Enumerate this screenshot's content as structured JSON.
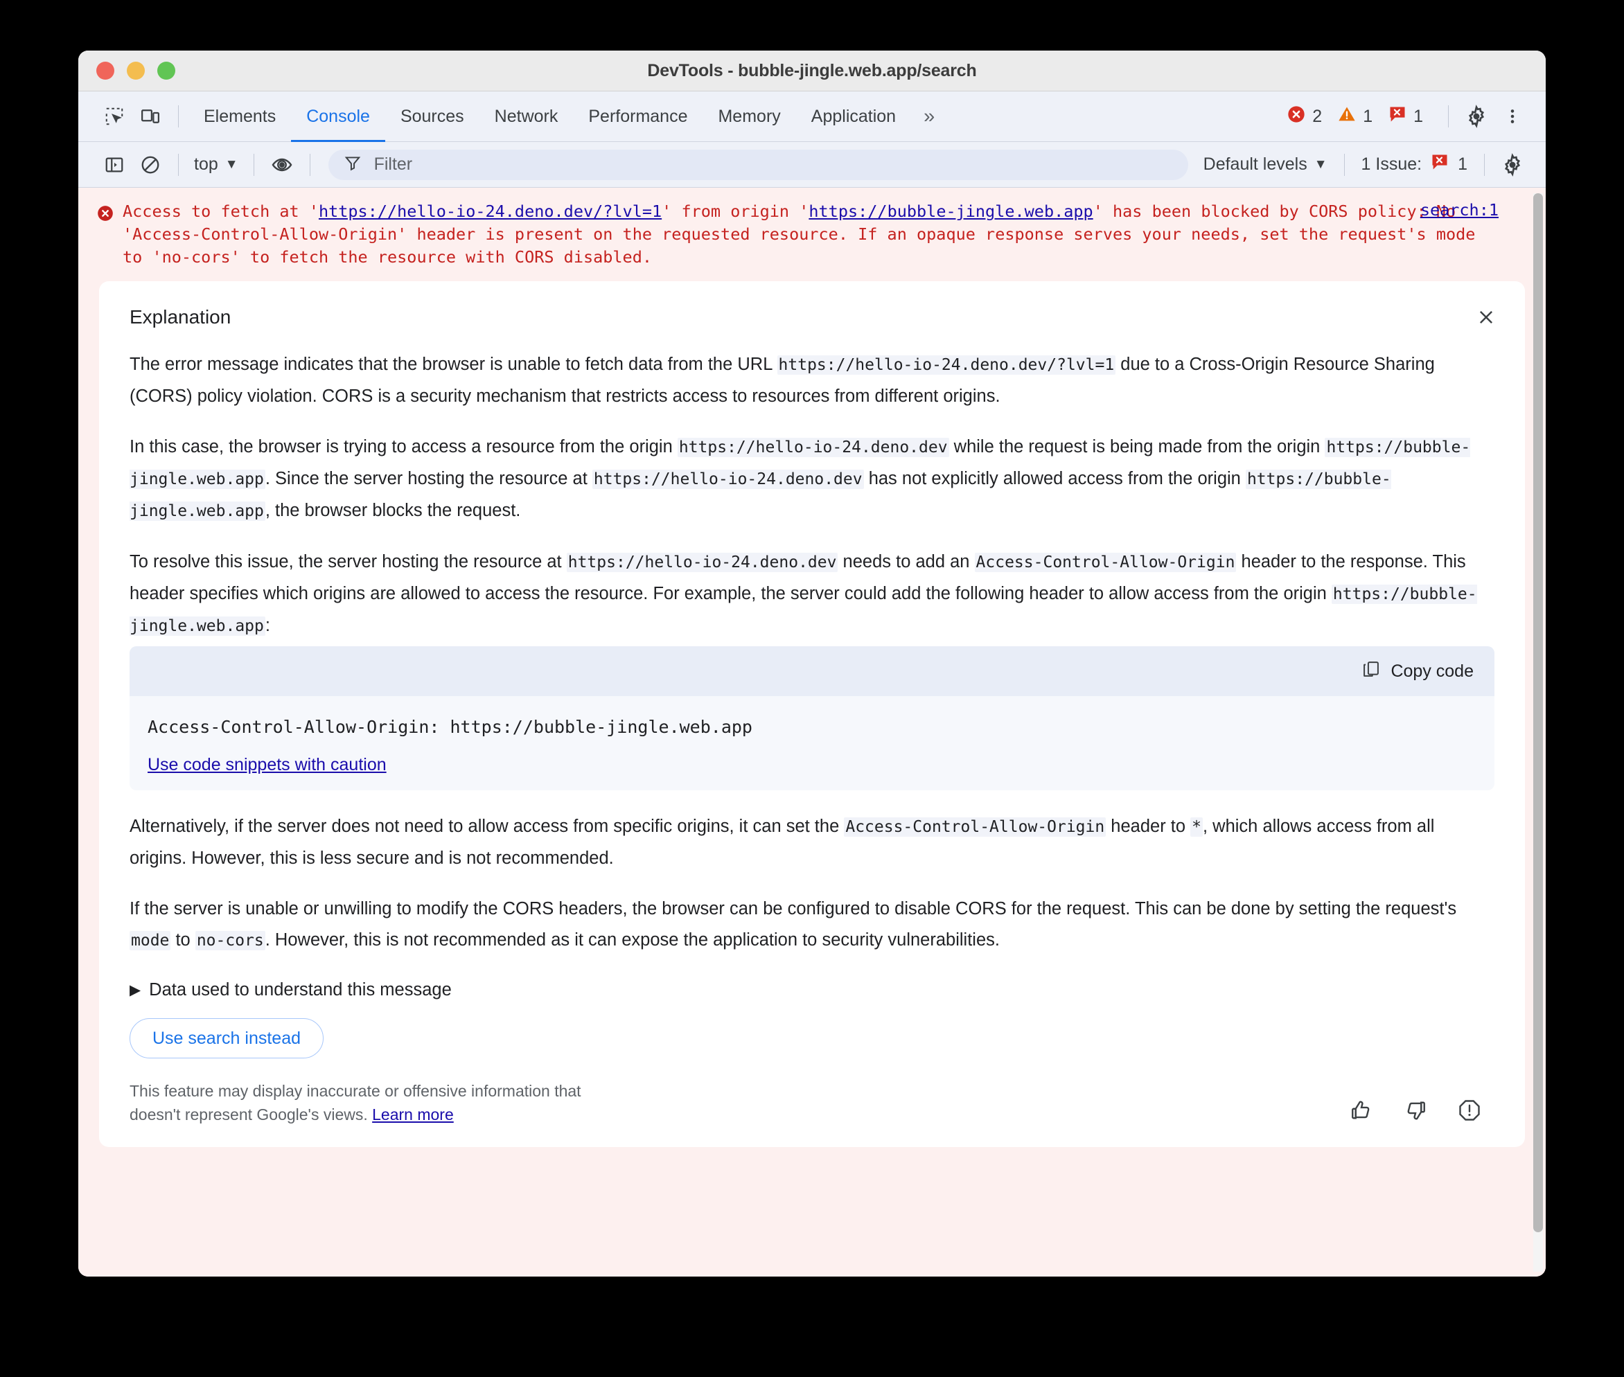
{
  "window": {
    "title": "DevTools - bubble-jingle.web.app/search",
    "traffic_lights": [
      "close",
      "minimize",
      "zoom"
    ]
  },
  "tabbar": {
    "inspect_icon": "inspect-element-icon",
    "device_icon": "device-toolbar-icon",
    "tabs": [
      {
        "label": "Elements",
        "active": false
      },
      {
        "label": "Console",
        "active": true
      },
      {
        "label": "Sources",
        "active": false
      },
      {
        "label": "Network",
        "active": false
      },
      {
        "label": "Performance",
        "active": false
      },
      {
        "label": "Memory",
        "active": false
      },
      {
        "label": "Application",
        "active": false
      }
    ],
    "more_tabs": "»",
    "counters": [
      {
        "name": "errors",
        "icon": "error-circle-icon",
        "count": "2",
        "color": "#d93025"
      },
      {
        "name": "warnings",
        "icon": "warning-triangle-icon",
        "count": "1",
        "color": "#e8710a"
      },
      {
        "name": "issues",
        "icon": "issue-speech-icon",
        "count": "1",
        "color": "#d93025"
      }
    ],
    "settings_icon": "gear-icon",
    "more_options_icon": "kebab-menu-icon"
  },
  "console_toolbar": {
    "sidebar_icon": "console-sidebar-icon",
    "clear_icon": "clear-console-icon",
    "context": "top",
    "context_caret": "▼",
    "eye_icon": "live-expression-eye-icon",
    "filter_icon": "filter-funnel-icon",
    "filter_value": "",
    "filter_placeholder": "Filter",
    "levels_label": "Default levels",
    "levels_caret": "▼",
    "issues_label": "1 Issue:",
    "issues_count": "1",
    "settings_icon": "gear-icon"
  },
  "console_message": {
    "icon": "error-circle-icon",
    "prefix": "Access to fetch at '",
    "url1": "https://hello-io-24.deno.dev/?lvl=1",
    "mid": "' from origin '",
    "url2": "https://bubble-jingle.web.app",
    "suffix": "' has been blocked by CORS policy: No 'Access-Control-Allow-Origin' header is present on the requested resource. If an opaque response serves your needs, set the request's mode to 'no-cors' to fetch the resource with CORS disabled.",
    "source_link": "search:1"
  },
  "explanation": {
    "title": "Explanation",
    "close_icon": "close-icon",
    "paragraphs": [
      {
        "parts": [
          {
            "t": "text",
            "v": "The error message indicates that the browser is unable to fetch data from the URL "
          },
          {
            "t": "code",
            "v": "https://hello-io-24.deno.dev/?lvl=1"
          },
          {
            "t": "text",
            "v": " due to a Cross-Origin Resource Sharing (CORS) policy violation. CORS is a security mechanism that restricts access to resources from different origins."
          }
        ]
      },
      {
        "parts": [
          {
            "t": "text",
            "v": "In this case, the browser is trying to access a resource from the origin "
          },
          {
            "t": "code",
            "v": "https://hello-io-24.deno.dev"
          },
          {
            "t": "text",
            "v": " while the request is being made from the origin "
          },
          {
            "t": "code",
            "v": "https://bubble-jingle.web.app"
          },
          {
            "t": "text",
            "v": ". Since the server hosting the resource at "
          },
          {
            "t": "code",
            "v": "https://hello-io-24.deno.dev"
          },
          {
            "t": "text",
            "v": " has not explicitly allowed access from the origin "
          },
          {
            "t": "code",
            "v": "https://bubble-jingle.web.app"
          },
          {
            "t": "text",
            "v": ", the browser blocks the request."
          }
        ]
      },
      {
        "parts": [
          {
            "t": "text",
            "v": "To resolve this issue, the server hosting the resource at "
          },
          {
            "t": "code",
            "v": "https://hello-io-24.deno.dev"
          },
          {
            "t": "text",
            "v": " needs to add an "
          },
          {
            "t": "code",
            "v": "Access-Control-Allow-Origin"
          },
          {
            "t": "text",
            "v": " header to the response. This header specifies which origins are allowed to access the resource. For example, the server could add the following header to allow access from the origin "
          },
          {
            "t": "code",
            "v": "https://bubble-jingle.web.app"
          },
          {
            "t": "text",
            "v": ":"
          }
        ]
      }
    ],
    "code_block": {
      "copy_label": "Copy code",
      "copy_icon": "copy-icon",
      "code": "Access-Control-Allow-Origin: https://bubble-jingle.web.app",
      "caution_link": "Use code snippets with caution"
    },
    "paragraphs_after": [
      {
        "parts": [
          {
            "t": "text",
            "v": "Alternatively, if the server does not need to allow access from specific origins, it can set the "
          },
          {
            "t": "code",
            "v": "Access-Control-Allow-Origin"
          },
          {
            "t": "text",
            "v": " header to "
          },
          {
            "t": "code",
            "v": "*"
          },
          {
            "t": "text",
            "v": ", which allows access from all origins. However, this is less secure and is not recommended."
          }
        ]
      },
      {
        "parts": [
          {
            "t": "text",
            "v": "If the server is unable or unwilling to modify the CORS headers, the browser can be configured to disable CORS for the request. This can be done by setting the request's "
          },
          {
            "t": "code",
            "v": "mode"
          },
          {
            "t": "text",
            "v": " to "
          },
          {
            "t": "code",
            "v": "no-cors"
          },
          {
            "t": "text",
            "v": ". However, this is not recommended as it can expose the application to security vulnerabilities."
          }
        ]
      }
    ],
    "disclosure": {
      "triangle": "▶",
      "label": "Data used to understand this message"
    },
    "use_search_button": "Use search instead",
    "disclaimer_text_1": "This feature may display inaccurate or offensive information that",
    "disclaimer_text_2": "doesn't represent Google's views. ",
    "disclaimer_link": "Learn more",
    "feedback": [
      {
        "name": "thumb-up-icon"
      },
      {
        "name": "thumb-down-icon"
      },
      {
        "name": "report-icon"
      }
    ]
  },
  "colors": {
    "accent": "#1a73e8",
    "error": "#d93025",
    "warning": "#e8710a",
    "link": "#1a0dab",
    "error_bg": "#fdf0ef",
    "toolbar_bg": "#eef1f8"
  }
}
